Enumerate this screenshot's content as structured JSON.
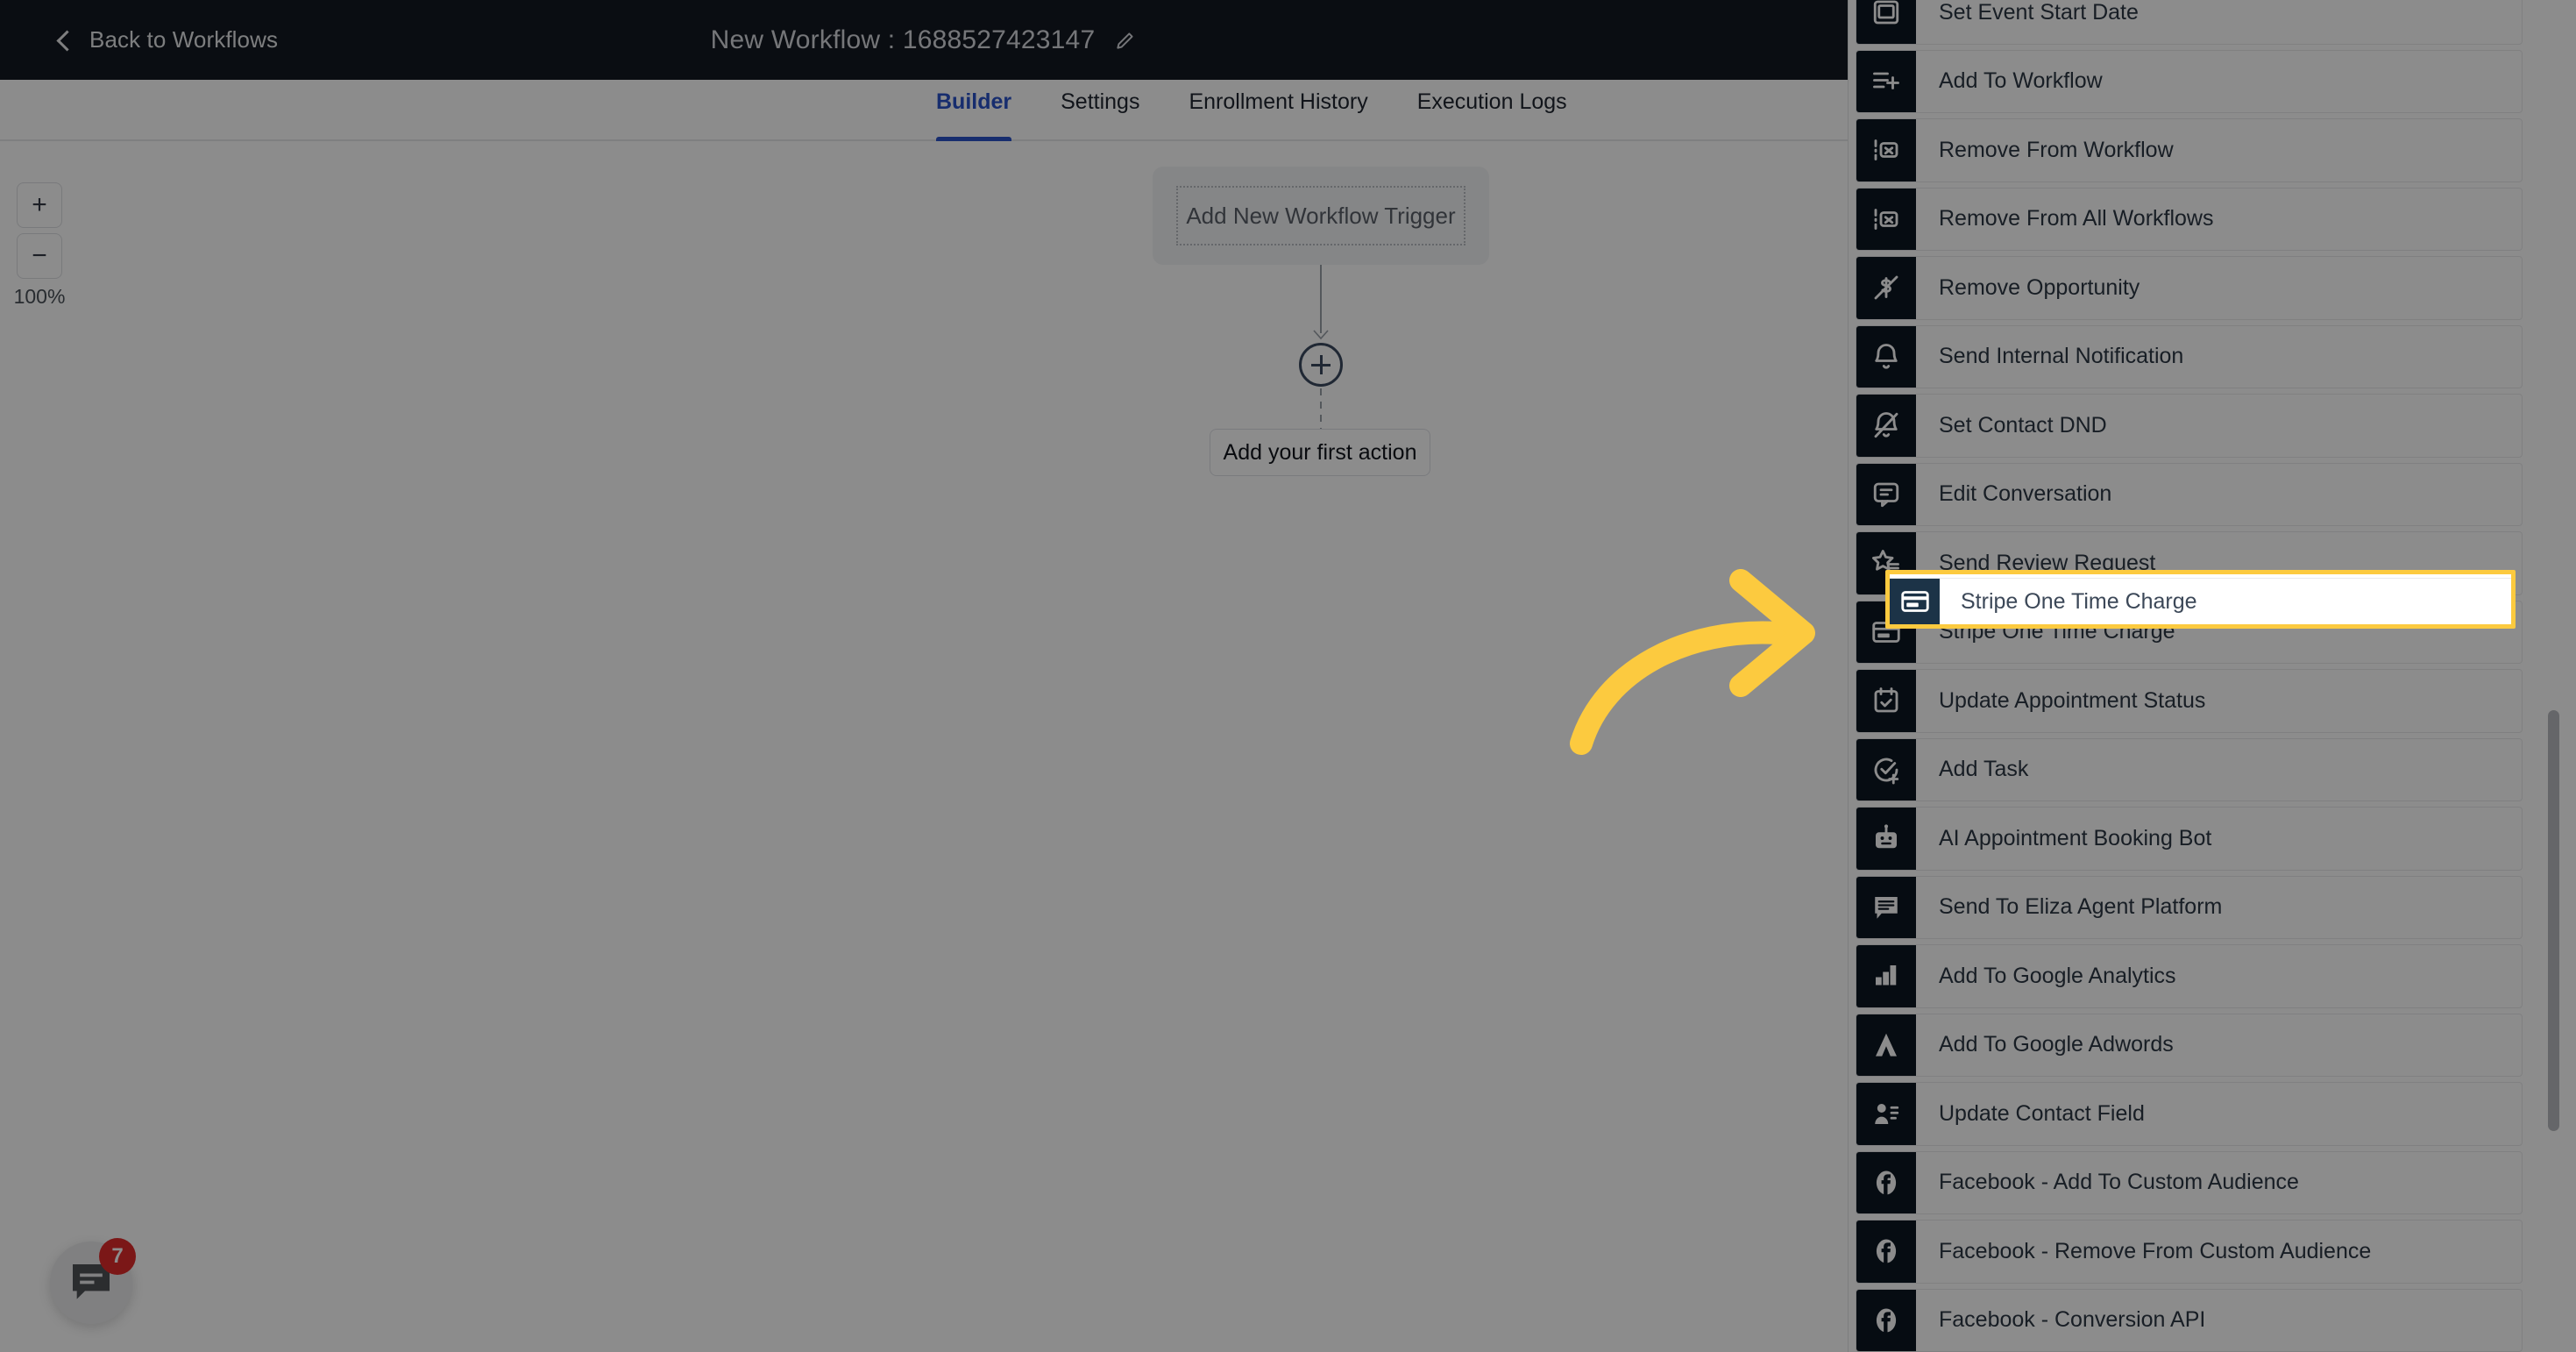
{
  "header": {
    "back_label": "Back to Workflows",
    "back_icon": "chevron-left-icon",
    "workflow_title": "New Workflow : 1688527423147",
    "edit_icon": "pencil-icon",
    "bar_color": "#131822"
  },
  "tabs": [
    {
      "label": "Builder",
      "active": true
    },
    {
      "label": "Settings",
      "active": false
    },
    {
      "label": "Enrollment History",
      "active": false
    },
    {
      "label": "Execution Logs",
      "active": false
    }
  ],
  "tab_accent_color": "#2a52c9",
  "canvas": {
    "zoom_in_label": "+",
    "zoom_out_label": "−",
    "zoom_level": "100%",
    "trigger_placeholder": "Add New Workflow Trigger",
    "add_node_icon": "plus-circle-icon",
    "first_action_label": "Add your first action"
  },
  "chat_widget": {
    "icon": "chat-bubble-icon",
    "badge_count": "7",
    "badge_color": "#e02b2b"
  },
  "actions_panel": {
    "scrollbar": "vertical-scrollbar",
    "items": [
      {
        "label": "Set Event Start Date",
        "icon": "calendar-event-icon"
      },
      {
        "label": "Add To Workflow",
        "icon": "list-plus-icon"
      },
      {
        "label": "Remove From Workflow",
        "icon": "list-remove-icon"
      },
      {
        "label": "Remove From All Workflows",
        "icon": "list-remove-icon"
      },
      {
        "label": "Remove Opportunity",
        "icon": "dollar-slash-icon"
      },
      {
        "label": "Send Internal Notification",
        "icon": "bell-icon"
      },
      {
        "label": "Set Contact DND",
        "icon": "bell-off-icon"
      },
      {
        "label": "Edit Conversation",
        "icon": "conversation-icon"
      },
      {
        "label": "Send Review Request",
        "icon": "star-list-icon"
      },
      {
        "label": "Stripe One Time Charge",
        "icon": "credit-card-icon",
        "highlighted": true
      },
      {
        "label": "Update Appointment Status",
        "icon": "calendar-check-icon"
      },
      {
        "label": "Add Task",
        "icon": "check-circle-plus-icon"
      },
      {
        "label": "AI Appointment Booking Bot",
        "icon": "robot-icon"
      },
      {
        "label": "Send To Eliza Agent Platform",
        "icon": "message-lines-icon"
      },
      {
        "label": "Add To Google Analytics",
        "icon": "analytics-bar-icon"
      },
      {
        "label": "Add To Google Adwords",
        "icon": "google-ads-icon"
      },
      {
        "label": "Update Contact Field",
        "icon": "contact-field-icon"
      },
      {
        "label": "Facebook - Add To Custom Audience",
        "icon": "facebook-icon"
      },
      {
        "label": "Facebook - Remove From Custom Audience",
        "icon": "facebook-icon"
      },
      {
        "label": "Facebook - Conversion API",
        "icon": "facebook-icon"
      }
    ]
  },
  "annotation": {
    "arrow_icon": "curved-arrow-right-icon",
    "highlight_color": "#fcca3f",
    "target_label": "Stripe One Time Charge"
  }
}
